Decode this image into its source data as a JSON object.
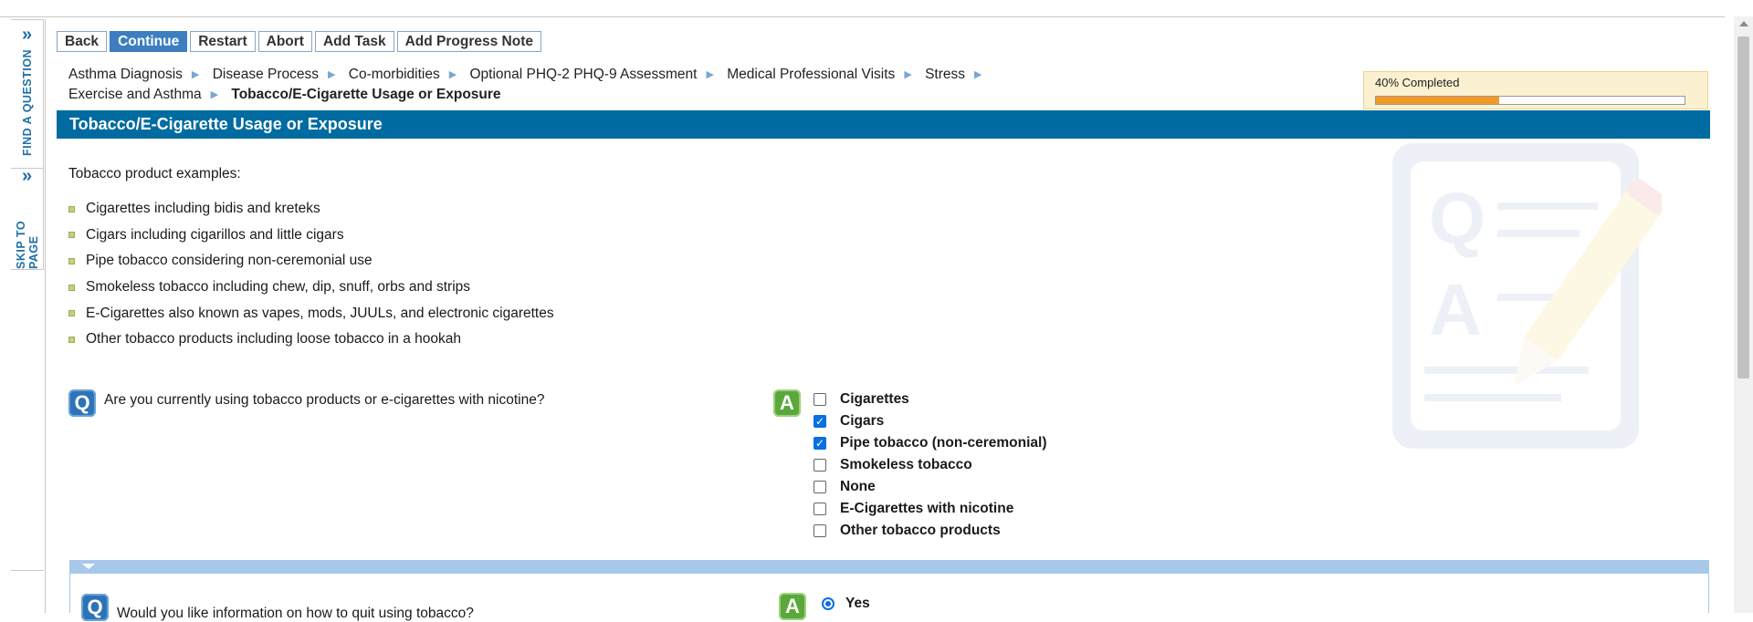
{
  "toolbar": {
    "back": "Back",
    "continue": "Continue",
    "restart": "Restart",
    "abort": "Abort",
    "add_task": "Add Task",
    "add_progress_note": "Add Progress Note"
  },
  "side_nav": {
    "find_question": "FIND A QUESTION",
    "skip_to_page": "SKIP TO PAGE"
  },
  "breadcrumb": {
    "items": [
      "Asthma Diagnosis",
      "Disease Process",
      "Co-morbidities",
      "Optional PHQ-2 PHQ-9 Assessment",
      "Medical Professional Visits",
      "Stress",
      "Exercise and Asthma"
    ],
    "current": "Tobacco/E-Cigarette Usage or Exposure"
  },
  "progress": {
    "label": "40% Completed",
    "fraction": 0.4,
    "bar_color": "#f29a26"
  },
  "section": {
    "title": "Tobacco/E-Cigarette Usage or Exposure",
    "header_color": "#006ba1"
  },
  "intro": "Tobacco product examples:",
  "examples": [
    "Cigarettes including bidis and kreteks",
    "Cigars including cigarillos and little cigars",
    "Pipe tobacco considering non-ceremonial use",
    "Smokeless tobacco including chew, dip, snuff, orbs and strips",
    "E-Cigarettes also known as vapes, mods, JUULs, and electronic cigarettes",
    "Other tobacco products including loose tobacco in a hookah"
  ],
  "question1": {
    "q_icon": "Q",
    "a_icon": "A",
    "text": "Are you currently using tobacco products or e-cigarettes with nicotine?",
    "options": [
      {
        "label": "Cigarettes",
        "checked": false
      },
      {
        "label": "Cigars",
        "checked": true
      },
      {
        "label": "Pipe tobacco (non-ceremonial)",
        "checked": true
      },
      {
        "label": "Smokeless tobacco",
        "checked": false
      },
      {
        "label": "None",
        "checked": false
      },
      {
        "label": "E-Cigarettes with nicotine",
        "checked": false
      },
      {
        "label": "Other tobacco products",
        "checked": false
      }
    ]
  },
  "question2": {
    "q_icon": "Q",
    "a_icon": "A",
    "text": "Would you like information on how to quit using tobacco?",
    "selected": "Yes"
  },
  "watermark": {
    "q": "Q",
    "a": "A"
  },
  "icons": {
    "chevron": "»",
    "check": "✓"
  }
}
